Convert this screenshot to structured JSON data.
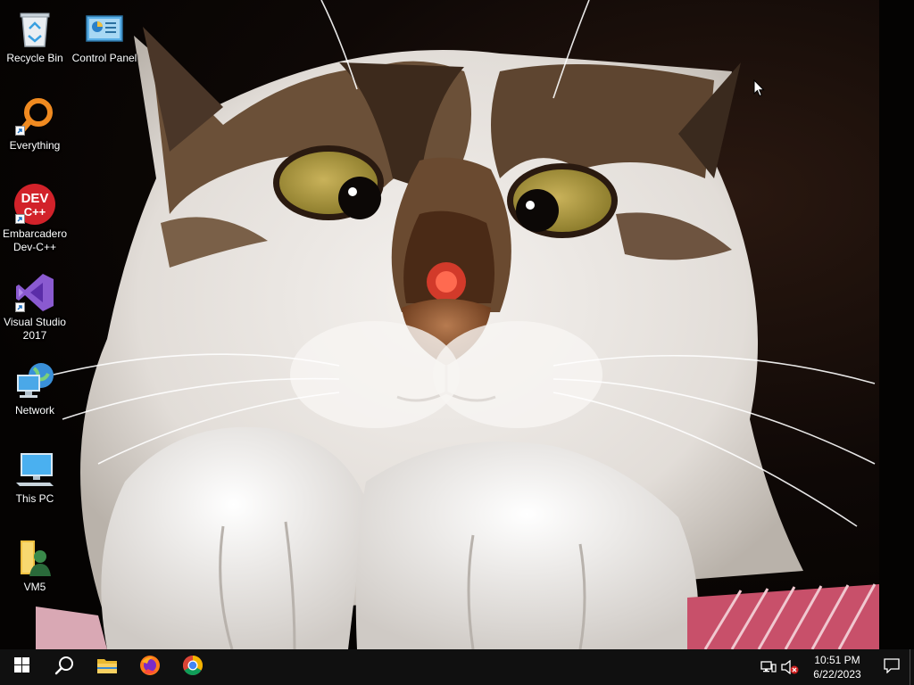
{
  "desktop": {
    "icons": [
      {
        "label": "Recycle Bin",
        "icon": "recycle-bin-icon"
      },
      {
        "label": "Control Panel",
        "icon": "control-panel-icon"
      },
      {
        "label": "Everything",
        "icon": "everything-search-icon"
      },
      {
        "label": "Embarcadero\nDev-C++",
        "icon": "dev-cpp-icon"
      },
      {
        "label": "Visual Studio\n2017",
        "icon": "visual-studio-icon"
      },
      {
        "label": "Network",
        "icon": "network-icon"
      },
      {
        "label": "This PC",
        "icon": "this-pc-icon"
      },
      {
        "label": "VM5",
        "icon": "user-folder-icon"
      }
    ],
    "dev_cpp_badge": {
      "line1": "DEV",
      "line2": "C++"
    },
    "wallpaper": "wallpaper-cat-image"
  },
  "taskbar": {
    "buttons": [
      {
        "name": "start",
        "icon": "windows-logo-icon"
      },
      {
        "name": "search",
        "icon": "search-icon"
      },
      {
        "name": "file-explorer",
        "icon": "folder-icon"
      },
      {
        "name": "firefox",
        "icon": "firefox-icon"
      },
      {
        "name": "chrome",
        "icon": "chrome-icon"
      }
    ],
    "tray": {
      "network": "network-tray-icon",
      "volume": "volume-muted-icon",
      "time": "10:51 PM",
      "date": "6/22/2023",
      "notifications": "action-center-icon"
    }
  },
  "colors": {
    "taskbar_bg": "#101010",
    "text": "#ffffff",
    "accent_blue": "#1e90ff"
  }
}
